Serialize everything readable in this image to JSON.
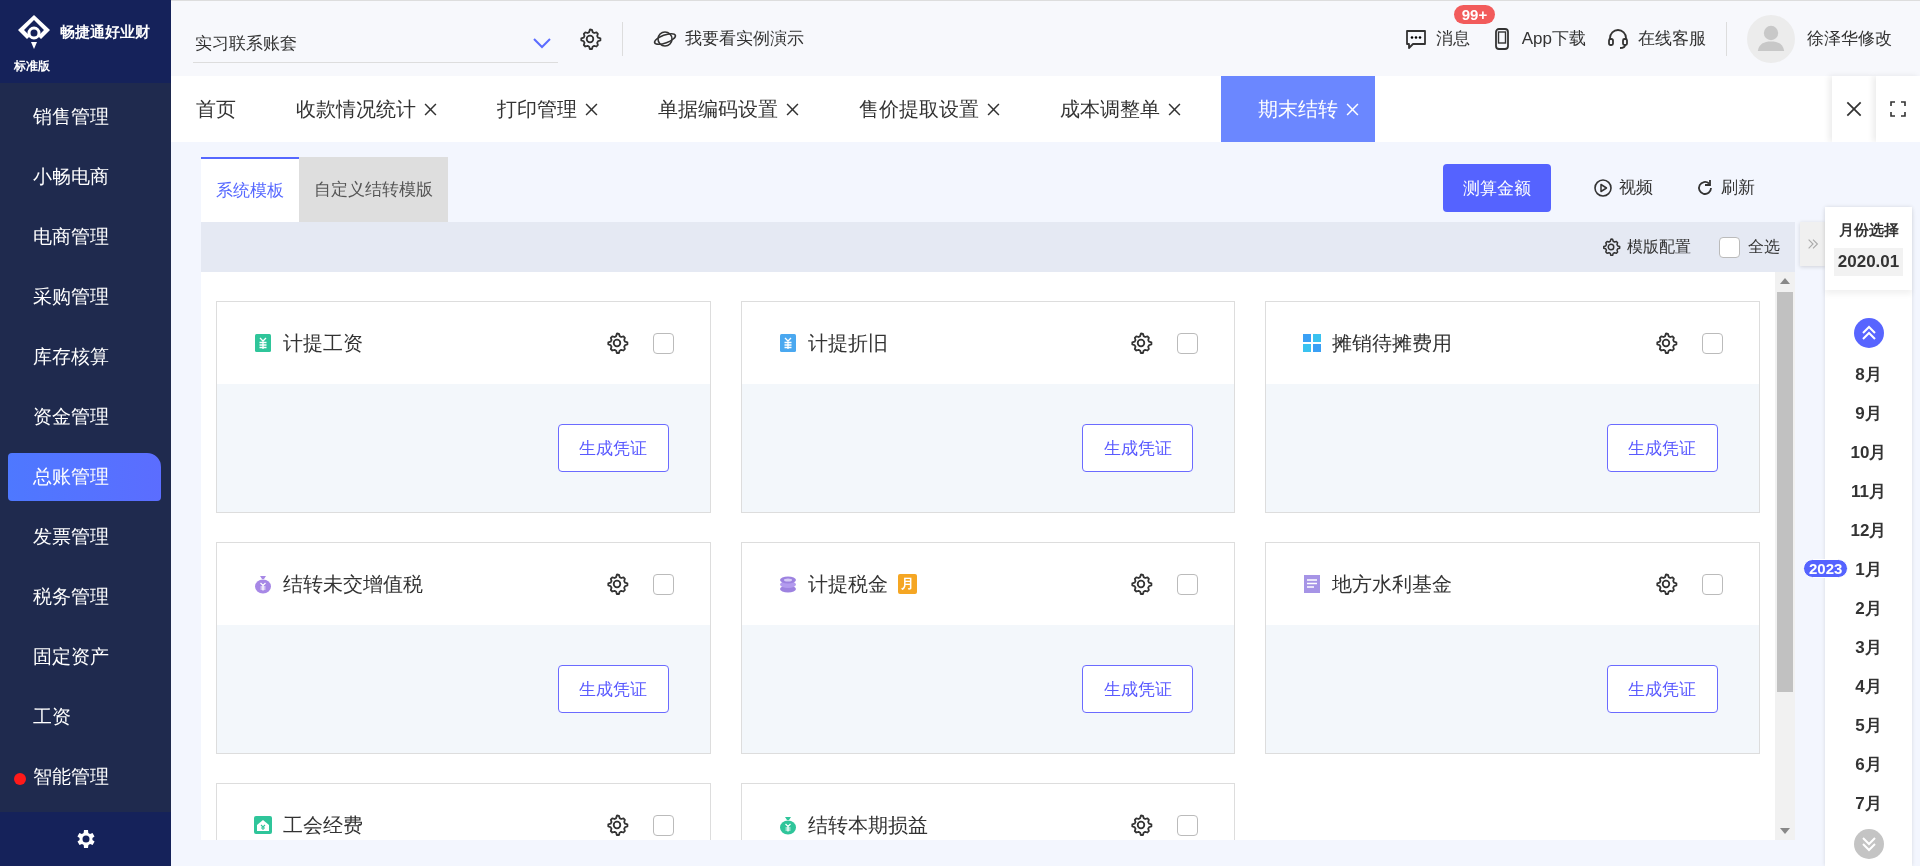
{
  "logo": {
    "name": "畅捷通好业财",
    "edition": "标准版"
  },
  "sidebar": {
    "items": [
      {
        "label": "销售管理",
        "selected": false,
        "dot": false
      },
      {
        "label": "小畅电商",
        "selected": false,
        "dot": false
      },
      {
        "label": "电商管理",
        "selected": false,
        "dot": false
      },
      {
        "label": "采购管理",
        "selected": false,
        "dot": false
      },
      {
        "label": "库存核算",
        "selected": false,
        "dot": false
      },
      {
        "label": "资金管理",
        "selected": false,
        "dot": false
      },
      {
        "label": "总账管理",
        "selected": true,
        "dot": false
      },
      {
        "label": "发票管理",
        "selected": false,
        "dot": false
      },
      {
        "label": "税务管理",
        "selected": false,
        "dot": false
      },
      {
        "label": "固定资产",
        "selected": false,
        "dot": false
      },
      {
        "label": "工资",
        "selected": false,
        "dot": false
      },
      {
        "label": "智能管理",
        "selected": false,
        "dot": true
      }
    ]
  },
  "topbar": {
    "account": {
      "value": "实习联系账套"
    },
    "demo": "我要看实例演示",
    "messages": {
      "label": "消息",
      "badge": "99+"
    },
    "app_download": "App下载",
    "service": "在线客服",
    "user": "徐泽华修改"
  },
  "tabs": [
    {
      "label": "首页",
      "closable": false,
      "selected": false
    },
    {
      "label": "收款情况统计",
      "closable": true,
      "selected": false
    },
    {
      "label": "打印管理",
      "closable": true,
      "selected": false
    },
    {
      "label": "单据编码设置",
      "closable": true,
      "selected": false
    },
    {
      "label": "售价提取设置",
      "closable": true,
      "selected": false
    },
    {
      "label": "成本调整单",
      "closable": true,
      "selected": false
    },
    {
      "label": "期末结转",
      "closable": true,
      "selected": true
    }
  ],
  "subtabs": [
    {
      "label": "系统模板",
      "selected": true
    },
    {
      "label": "自定义结转模版",
      "selected": false
    }
  ],
  "actions": {
    "calculate": "测算金额",
    "video": "视频",
    "refresh": "刷新"
  },
  "toolbar": {
    "template_config": "模版配置",
    "select_all": {
      "label": "全选",
      "checked": false
    }
  },
  "cards": [
    {
      "title": "计提工资",
      "checked": false,
      "button": "生成凭证"
    },
    {
      "title": "计提折旧",
      "checked": false,
      "button": "生成凭证"
    },
    {
      "title": "摊销待摊费用",
      "checked": false,
      "button": "生成凭证"
    },
    {
      "title": "结转未交增值税",
      "checked": false,
      "button": "生成凭证"
    },
    {
      "title": "计提税金",
      "tag": "月",
      "checked": false,
      "button": "生成凭证"
    },
    {
      "title": "地方水利基金",
      "checked": false,
      "button": "生成凭证"
    },
    {
      "title": "工会经费",
      "checked": false
    },
    {
      "title": "结转本期损益",
      "checked": false
    }
  ],
  "month_panel": {
    "title": "月份选择",
    "current": "2020.01",
    "months": [
      {
        "label": "8月"
      },
      {
        "label": "9月"
      },
      {
        "label": "10月"
      },
      {
        "label": "11月"
      },
      {
        "label": "12月"
      },
      {
        "label": "1月",
        "year": "2023"
      },
      {
        "label": "2月"
      },
      {
        "label": "3月"
      },
      {
        "label": "4月"
      },
      {
        "label": "5月"
      },
      {
        "label": "6月"
      },
      {
        "label": "7月"
      }
    ]
  }
}
